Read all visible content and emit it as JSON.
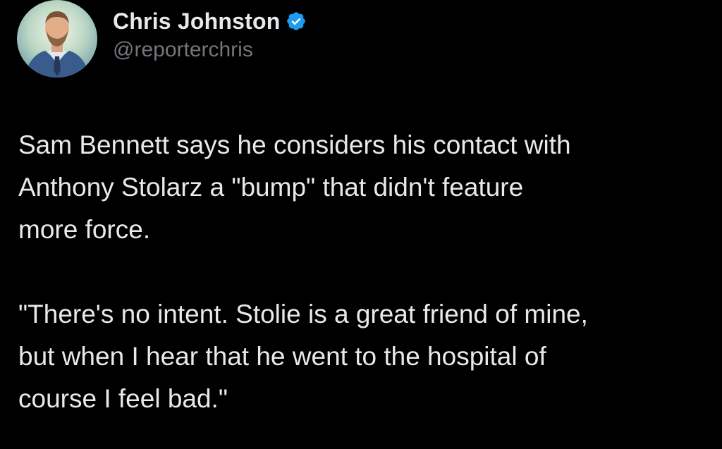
{
  "author": {
    "display_name": "Chris Johnston",
    "handle": "@reporterchris",
    "verified_icon": "verified-badge-icon",
    "avatar_icon": "avatar-photo"
  },
  "tweet": {
    "paragraphs": [
      "Sam Bennett says he considers his contact with\nAnthony Stolarz a \"bump\" that didn't feature\nmore force.",
      "\"There's no intent. Stolie is a great friend of mine,\nbut when I hear that he went to the hospital of\ncourse I feel bad.\""
    ]
  },
  "colors": {
    "background": "#000000",
    "text_primary": "#e7e9ea",
    "text_secondary": "#71767b",
    "verified_blue": "#1d9bf0"
  }
}
